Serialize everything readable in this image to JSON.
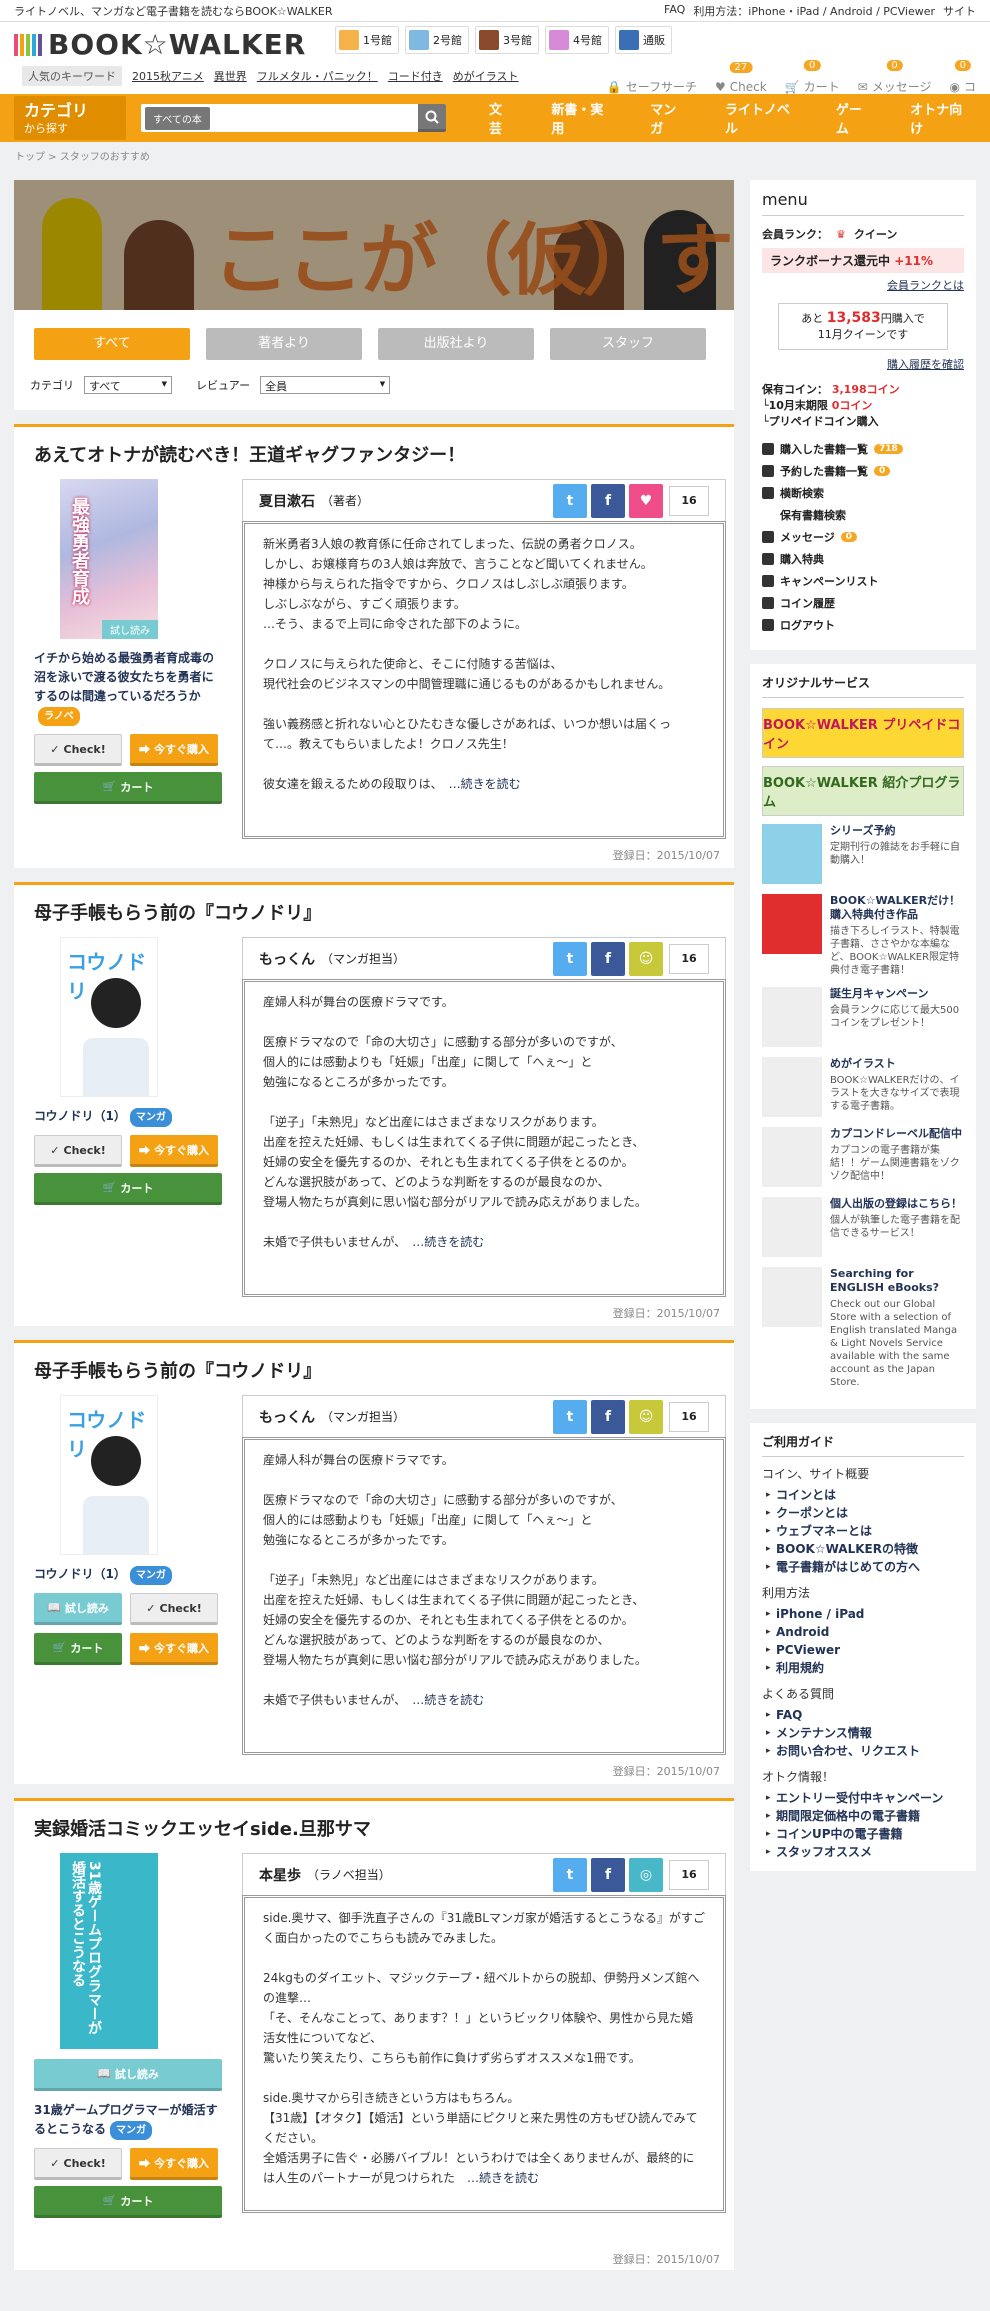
{
  "topbar": {
    "tagline": "ライトノベル、マンガなど電子書籍を読むならBOOK☆WALKER",
    "links": [
      "FAQ",
      "利用方法：iPhone・iPad / Android / PCViewer",
      "サイト"
    ]
  },
  "header": {
    "logo": "BOOK☆WALKER",
    "stores": [
      {
        "label": "1号館",
        "color": "#f5b24a"
      },
      {
        "label": "2号館",
        "color": "#7fb9e0"
      },
      {
        "label": "3号館",
        "color": "#8a4a2e"
      },
      {
        "label": "4号館",
        "color": "#d78ad8"
      },
      {
        "label": "通販",
        "color": "#3a6fb5"
      }
    ],
    "keyword_label": "人気のキーワード",
    "keywords": [
      "2015秋アニメ",
      "異世界",
      "フルメタル・パニック！",
      "コード付き",
      "めがイラスト"
    ],
    "icons": [
      {
        "icon": "lock-icon",
        "label": "セーフサーチ",
        "badge": ""
      },
      {
        "icon": "heart-icon",
        "label": "Check",
        "badge": "27"
      },
      {
        "icon": "cart-icon",
        "label": "カート",
        "badge": "0"
      },
      {
        "icon": "mail-icon",
        "label": "メッセージ",
        "badge": "0"
      },
      {
        "icon": "coin-icon",
        "label": "コ",
        "badge": "0"
      }
    ]
  },
  "nav": {
    "cat_big": "カテゴリ",
    "cat_small": "から探す",
    "search_select": "すべての本",
    "links": [
      "文芸",
      "新書・実用",
      "マンガ",
      "ライトノベル",
      "ゲーム",
      "オトナ向け"
    ]
  },
  "breadcrumb": "トップ > スタッフのおすすめ",
  "banner": {
    "title": "ここが（仮）すすめ"
  },
  "filters": {
    "buttons": [
      "すべて",
      "著者より",
      "出版社より",
      "スタッフ"
    ],
    "category_label": "カテゴリ",
    "category_value": "すべて",
    "reviewer_label": "レビュアー",
    "reviewer_value": "全員"
  },
  "buttons": {
    "check": "Check!",
    "buy": "今すぐ購入",
    "cart": "カート",
    "trial": "試し読み",
    "more": "…続きを読む"
  },
  "entries": [
    {
      "title": "あえてオトナが読むべき！王道ギャグファンタジー！",
      "book_title": "イチから始める最強勇者育成毒の沼を泳いで渡る彼女たちを勇者にするのは間違っているだろうか",
      "tag": "ラノベ",
      "cover_text": "最強勇者育成",
      "cover_trial": "試し読み",
      "reviewer": "夏目漱石",
      "role": "（著者）",
      "count": "16",
      "react": "heart-icon",
      "body": "新米勇者3人娘の教育係に任命されてしまった、伝説の勇者クロノス。\nしかし、お嬢様育ちの3人娘は奔放で、言うことなど聞いてくれません。\n神様から与えられた指令ですから、クロノスはしぶしぶ頑張ります。\nしぶしぶながら、すごく頑張ります。\n…そう、まるで上司に命令された部下のように。\n\nクロノスに与えられた使命と、そこに付随する苦悩は、\n現代社会のビジネスマンの中間管理職に通じるものがあるかもしれません。\n\n強い義務感と折れない心とひたむきな優しさがあれば、いつか想いは届くって…。教えてもらいましたよ！クロノス先生！\n\n彼女達を鍛えるための段取りは、",
      "date": "登録日：2015/10/07"
    },
    {
      "title": "母子手帳もらう前の『コウノドリ』",
      "book_title": "コウノドリ（1）",
      "tag": "マンガ",
      "cover_text": "コウノドリ",
      "cover_trial": "",
      "reviewer": "もっくん",
      "role": "（マンガ担当）",
      "count": "16",
      "react": "smile-icon",
      "body": "産婦人科が舞台の医療ドラマです。\n\n医療ドラマなので「命の大切さ」に感動する部分が多いのですが、\n個人的には感動よりも「妊娠」「出産」に関して「へぇ～」と\n勉強になるところが多かったです。\n\n「逆子」「未熟児」など出産にはさまざまなリスクがあります。\n出産を控えた妊婦、もしくは生まれてくる子供に問題が起こったとき、\n妊婦の安全を優先するのか、それとも生まれてくる子供をとるのか。\nどんな選択肢があって、どのような判断をするのが最良なのか、\n登場人物たちが真剣に思い悩む部分がリアルで読み応えがありました。\n\n未婚で子供もいませんが、",
      "date": "登録日：2015/10/07"
    },
    {
      "title": "母子手帳もらう前の『コウノドリ』",
      "book_title": "コウノドリ（1）",
      "tag": "マンガ",
      "cover_text": "コウノドリ",
      "cover_trial": "",
      "reviewer": "もっくん",
      "role": "（マンガ担当）",
      "count": "16",
      "react": "smile-icon",
      "body": "産婦人科が舞台の医療ドラマです。\n\n医療ドラマなので「命の大切さ」に感動する部分が多いのですが、\n個人的には感動よりも「妊娠」「出産」に関して「へぇ～」と\n勉強になるところが多かったです。\n\n「逆子」「未熟児」など出産にはさまざまなリスクがあります。\n出産を控えた妊婦、もしくは生まれてくる子供に問題が起こったとき、\n妊婦の安全を優先するのか、それとも生まれてくる子供をとるのか。\nどんな選択肢があって、どのような判断をするのが最良なのか、\n登場人物たちが真剣に思い悩む部分がリアルで読み応えがありました。\n\n未婚で子供もいませんが、",
      "date": "登録日：2015/10/07"
    },
    {
      "title": "実録婚活コミックエッセイside.旦那サマ",
      "book_title": "31歳ゲームプログラマーが婚活するとこうなる",
      "tag": "マンガ",
      "cover_text": "31歳ゲームプログラマーが婚活するとこうなる",
      "cover_trial": "",
      "reviewer": "本星歩",
      "role": "（ラノベ担当）",
      "count": "16",
      "react": "bw-icon",
      "body": "side.奥サマ、御手洗直子さんの『31歳BLマンガ家が婚活するとこうなる』がすごく面白かったのでこちらも読みでみました。\n\n24kgものダイエット、マジックテープ・紐ベルトからの脱却、伊勢丹メンズ館への進撃…\n「そ、そんなことって、あります？！」というビックリ体験や、男性から見た婚活女性についてなど、\n驚いたり笑えたり、こちらも前作に負けず劣らずオススメな1冊です。\n\nside.奥サマから引き続きという方はもちろん。\n【31歳】【オタク】【婚活】という単語にピクリと来た男性の方もぜひ読んでみてください。\n全婚活男子に告ぐ・必勝バイブル！というわけでは全くありませんが、最終的には人生のパートナーが見つけられた",
      "date": "登録日：2015/10/07"
    }
  ],
  "menu": {
    "title": "menu",
    "rank_label": "会員ランク：",
    "rank_value": "クイーン",
    "bonus_label": "ランクボーナス還元中",
    "bonus_value": "+11%",
    "rank_link": "会員ランクとは",
    "need_pre": "あと",
    "need_value": "13,583",
    "need_post": "円購入で",
    "need_line2": "11月クイーンです",
    "history_link": "購入履歴を確認",
    "coin_label": "保有コイン：",
    "coin_value": "3,198コイン",
    "expire_label": "└10月末期限",
    "expire_value": "0コイン",
    "prepaid": "└プリペイドコイン購入",
    "items": [
      {
        "label": "購入した書籍一覧",
        "badge": "718"
      },
      {
        "label": "予約した書籍一覧",
        "badge": "0"
      },
      {
        "label": "横断検索",
        "badge": ""
      },
      {
        "label": "保有書籍検索",
        "badge": ""
      },
      {
        "label": "メッセージ",
        "badge": "0"
      },
      {
        "label": "購入特典",
        "badge": ""
      },
      {
        "label": "キャンペーンリスト",
        "badge": ""
      },
      {
        "label": "コイン履歴",
        "badge": ""
      },
      {
        "label": "ログアウト",
        "badge": ""
      }
    ]
  },
  "services": {
    "title": "オリジナルサービス",
    "banner1": "BOOK☆WALKER プリペイドコイン",
    "banner2": "BOOK☆WALKER 紹介プログラム",
    "items": [
      {
        "title": "シリーズ予約",
        "desc": "定期刊行の雑誌をお手軽に自動購入！"
      },
      {
        "title": "BOOK☆WALKERだけ！購入特典付き作品",
        "desc": "描き下ろしイラスト、特製電子書籍、ささやかな本編など、BOOK☆WALKER限定特典付き電子書籍！"
      },
      {
        "title": "誕生月キャンペーン",
        "desc": "会員ランクに応じて最大500コインをプレゼント！"
      },
      {
        "title": "めがイラスト",
        "desc": "BOOK☆WALKERだけの、イラストを大きなサイズで表現する電子書籍。"
      },
      {
        "title": "カプコンドレーベル配信中",
        "desc": "カプコンの電子書籍が集結！！ゲーム関連書籍をゾクゾク配信中！"
      },
      {
        "title": "個人出版の登録はこちら！",
        "desc": "個人が執筆した電子書籍を配信できるサービス！"
      },
      {
        "title": "Searching for ENGLISH eBooks?",
        "desc": "Check out our Global Store with a selection of English translated Manga & Light Novels Service available with the same account as the Japan Store."
      }
    ]
  },
  "guide": {
    "title": "ご利用ガイド",
    "sections": [
      {
        "name": "コイン、サイト概要",
        "items": [
          "コインとは",
          "クーポンとは",
          "ウェブマネーとは",
          "BOOK☆WALKERの特徴",
          "電子書籍がはじめての方へ"
        ]
      },
      {
        "name": "利用方法",
        "items": [
          "iPhone / iPad",
          "Android",
          "PCViewer",
          "利用規約"
        ]
      },
      {
        "name": "よくある質問",
        "items": [
          "FAQ",
          "メンテナンス情報",
          "お問い合わせ、リクエスト"
        ]
      },
      {
        "name": "オトク情報！",
        "items": [
          "エントリー受付中キャンペーン",
          "期間限定価格中の電子書籍",
          "コインUP中の電子書籍",
          "スタッフオススメ"
        ]
      }
    ]
  }
}
